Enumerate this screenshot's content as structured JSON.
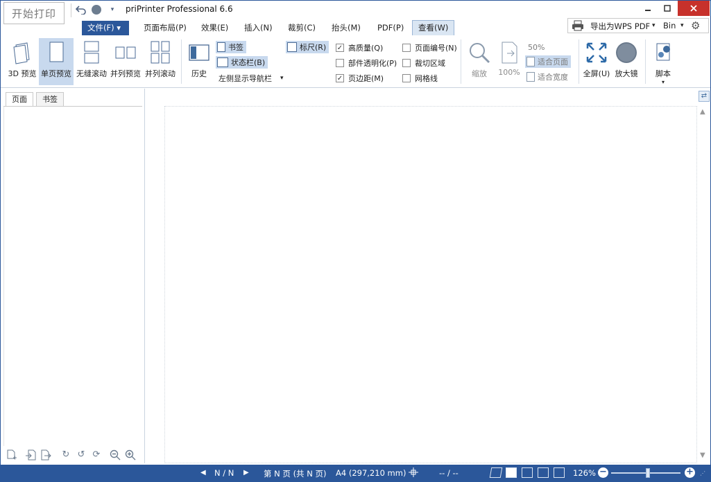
{
  "titlebar": {
    "start_print": "开始打印",
    "app_title": "priPrinter Professional 6.6",
    "undo_icon": "undo-icon",
    "circle_icon": "circle-icon",
    "qa_dropdown_icon": "dropdown-icon"
  },
  "menu": {
    "file": "文件(F)",
    "tabs": [
      "页面布局(P)",
      "效果(E)",
      "插入(N)",
      "裁剪(C)",
      "抬头(M)",
      "PDF(P)",
      "查看(W)"
    ],
    "active_tab": "查看(W)"
  },
  "export": {
    "label": "导出为WPS PDF",
    "bin": "Bin"
  },
  "ribbon": {
    "view_modes": [
      "3D 预览",
      "单页预览",
      "无缝滚动",
      "并列预览",
      "并列滚动"
    ],
    "selected_mode": "单页预览",
    "history": "历史",
    "bookmark": "书签",
    "statusbar": "状态栏(B)",
    "nav_dropdown": "左侧显示导航栏",
    "ruler": "标尺(R)",
    "checkboxes": [
      {
        "label": "高质量(Q)",
        "checked": true
      },
      {
        "label": "部件透明化(P)",
        "checked": false
      },
      {
        "label": "页边距(M)",
        "checked": true
      },
      {
        "label": "页面编号(N)",
        "checked": false
      },
      {
        "label": "裁切区域",
        "checked": false
      },
      {
        "label": "网格线",
        "checked": false
      }
    ],
    "zoom": "缩放",
    "zoom_100": "100%",
    "zoom_50": "50%",
    "fit_page": "适合页面",
    "fit_width": "适合宽度",
    "fullscreen": "全屏(U)",
    "magnifier": "放大镜",
    "script": "脚本"
  },
  "leftpanel": {
    "tabs": [
      "页面",
      "书签"
    ],
    "active_tab": "页面"
  },
  "statusbar": {
    "page_counter": "N / N",
    "page_info": "第 N 页 (共 N 页)",
    "paper_size": "A4 (297,210 mm)",
    "coords": "-- / --",
    "zoom_level": "126%",
    "zoom_fraction": 0.55
  },
  "colors": {
    "accent": "#2b579a",
    "selected": "#c8d9ee",
    "close": "#c7312b"
  }
}
